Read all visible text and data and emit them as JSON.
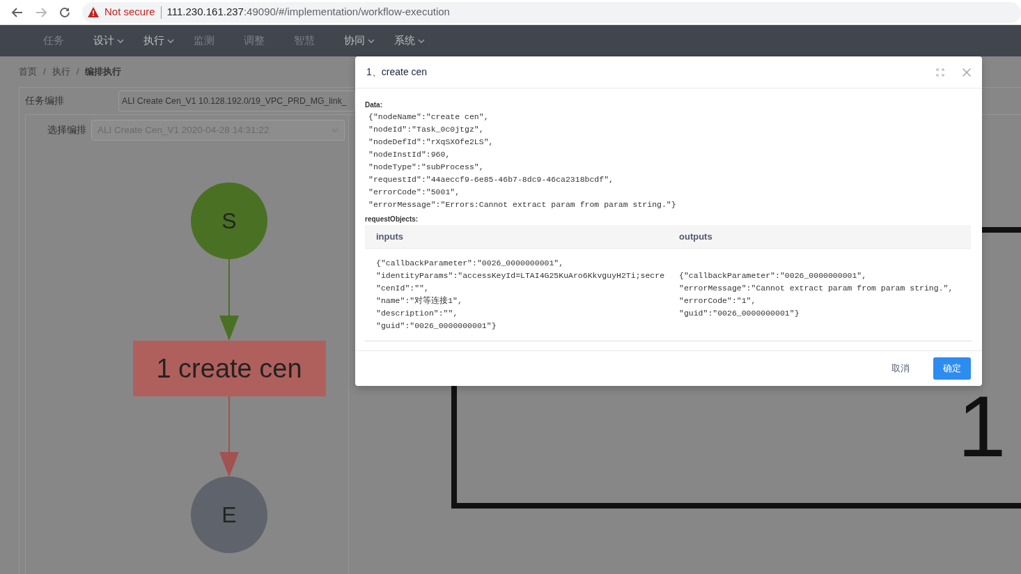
{
  "browser": {
    "security": "Not secure",
    "url_host": "111.230.161.237",
    "url_rest": ":49090/#/implementation/workflow-execution"
  },
  "nav": [
    {
      "label": "任务",
      "kind": "link"
    },
    {
      "label": "设计",
      "kind": "dropdown"
    },
    {
      "label": "执行",
      "kind": "dropdown"
    },
    {
      "label": "监测",
      "kind": "link"
    },
    {
      "label": "调整",
      "kind": "link"
    },
    {
      "label": "智慧",
      "kind": "link"
    },
    {
      "label": "协同",
      "kind": "dropdown"
    },
    {
      "label": "系统",
      "kind": "dropdown"
    }
  ],
  "breadcrumb": [
    {
      "label": "首页",
      "current": false
    },
    {
      "separator": "/",
      "label": "执行",
      "current": false
    },
    {
      "separator": "/",
      "label": "编排执行",
      "current": true
    }
  ],
  "form": {
    "task_label": "任务编排",
    "task_value": "ALI Create Cen_V1 10.128.192.0/19_VPC_PRD_MG_link_",
    "select_label": "选择编排",
    "select_value": "ALI Create Cen_V1 2020-04-28 14:31:22",
    "select_disabled": true
  },
  "diagram": {
    "nodes": [
      {
        "kind": "start",
        "label": "S"
      },
      {
        "kind": "task",
        "label": "1 create cen"
      },
      {
        "kind": "end",
        "label": "E"
      }
    ]
  },
  "zoomed_view": {
    "fragments": [
      "1"
    ]
  },
  "modal": {
    "title": "1、create cen",
    "data_label": "Data:",
    "data_lines": [
      "{\"nodeName\":\"create cen\",",
      "\"nodeId\":\"Task_0c0jtgz\",",
      "\"nodeDefId\":\"rXqSXOfe2LS\",",
      "\"nodeInstId\":960,",
      "\"nodeType\":\"subProcess\",",
      "\"requestId\":\"44aeccf9-6e85-46b7-8dc9-46ca2318bcdf\",",
      "\"errorCode\":\"5001\",",
      "\"errorMessage\":\"Errors:Cannot extract param from param string.\"}"
    ],
    "request_label": "requestObjects:",
    "columns": [
      "inputs",
      "outputs"
    ],
    "inputs_lines": [
      "{\"callbackParameter\":\"0026_0000000001\",",
      "\"identityParams\":\"accessKeyId=LTAI4G25KuAro6KkvguyH2Ti;secre",
      "\"cenId\":\"\",",
      "\"name\":\"对等连接1\",",
      "\"description\":\"\",",
      "\"guid\":\"0026_0000000001\"}"
    ],
    "outputs_lines": [
      "{\"callbackParameter\":\"0026_0000000001\",",
      "\"errorMessage\":\"Cannot extract param from param string.\",",
      "\"errorCode\":\"1\",",
      "\"guid\":\"0026_0000000001\"}"
    ],
    "buttons": [
      {
        "label": "取消",
        "kind": "secondary"
      },
      {
        "label": "确定",
        "kind": "primary"
      }
    ]
  }
}
